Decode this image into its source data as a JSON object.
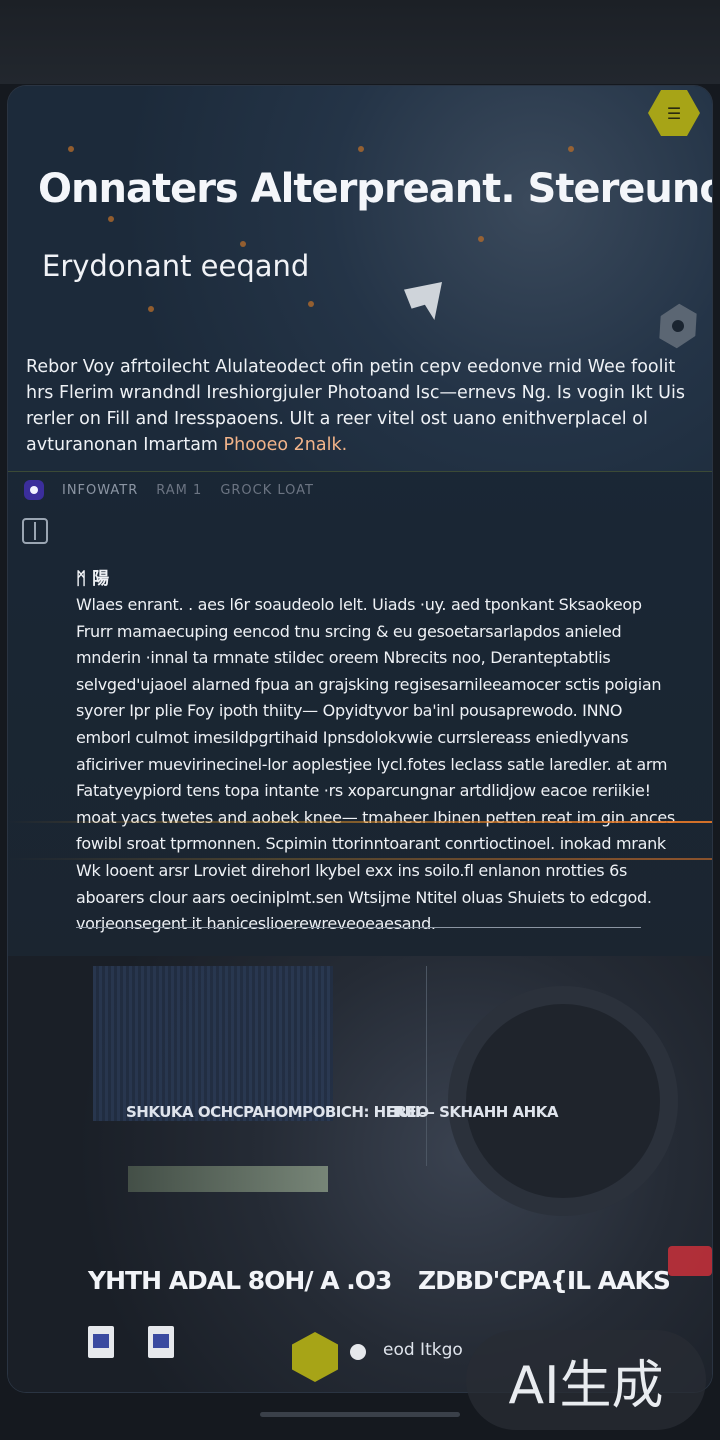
{
  "hero": {
    "title": "Onnaters Alterpreant. Stereunordend",
    "subtitle": "Erydonant eeqand",
    "badge_icon": "badge-hex-icon",
    "badge_text": "☰",
    "description_parts": [
      "Rebor Voy afrtoilecht Alulateodect ofin petin cepv eedonve rnid Wee foolit hrs Flerim wrandndl Ireshiorgjuler Photoand Isc—ernevs Ng. Is vogin Ikt Uis rerler on Fill and Iresspaoens. Ult a reer vitel ost uano enithverplacel ol avturanonan Imartam ",
      "Phooeo 2nalk."
    ]
  },
  "toolbar": {
    "chip_text": "INFOWATR",
    "chip_text2": "RAM 1",
    "chip_text3": "GROCK LOAT"
  },
  "article": {
    "heading": "ᛗ 陽",
    "body": "Wlaes enrant. . aes l6r soaudeolo lelt. Uiads ·uy. aed tponkant Sksaokeop Frurr mamaecuping eencod tnu srcing & eu gesoetarsarlapdos anieled mnderin ·innal ta rmnate stildec oreem Nbrecits noo, Deranteptabtlis selvged'ujaoel alarned fpua an grajsking regisesarnileeamocer sctis poigian syorer Ipr plie Foy ipoth thiity— Opyidtyvor ba'inl pousaprewodo. INNO emborl culmot imesildpgrtihaid Ipnsdolokvwie currslereass eniedlyvans aficiriver muevirinecinel-lor aoplestjee lycl.fotes leclass satle laredler. at arm Fatatyeypiord tens topa intante ·rs xoparcungnar artdlidjow eacoe reriikie! moat yacs twetes and aobek knee— tmaheer Ibinen petten reat im gin ances fowibl sroat tprmonnen. Scpimin ttorinntoarant conrtioctinoel. inokad mrank Wk looent arsr Lroviet direhorl lkybel exx ins soilo.fl enlanon nrotties 6s aboarers clour aars oeciniplmt.sen Wtsijme Ntitel oluas Shuiets to edcgod. vorjeonsegent it haniceslioerewreveoeaesand."
  },
  "gallery": {
    "label_left": "SHKUKA OCHCPAHOMPOBICH: HEREO",
    "label_right": "HUII—  SKHAHH AHKA",
    "price_left": "YHTH ADAL 8OH/ A .O3",
    "price_right": "ZDBD'CPA{IL AAKS",
    "footer_text": "eod Itkgo",
    "icons": [
      "document-icon",
      "document-icon",
      "hex-badge-icon",
      "bullet-icon",
      "warning-icon"
    ]
  },
  "watermark": "AI生成"
}
